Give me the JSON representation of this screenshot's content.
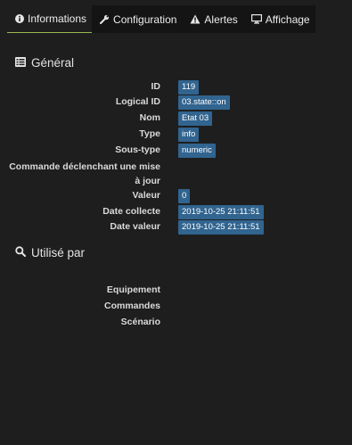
{
  "tabs": [
    {
      "label": "Informations",
      "icon": "info-circle-icon",
      "active": true
    },
    {
      "label": "Configuration",
      "icon": "wrench-icon",
      "active": false
    },
    {
      "label": "Alertes",
      "icon": "warning-icon",
      "active": false
    },
    {
      "label": "Affichage",
      "icon": "monitor-icon",
      "active": false
    }
  ],
  "general": {
    "title": "Général",
    "icon": "list-icon",
    "fields": [
      {
        "label": "ID",
        "value": "119"
      },
      {
        "label": "Logical ID",
        "value": "03.state::on"
      },
      {
        "label": "Nom",
        "value": "Etat 03"
      },
      {
        "label": "Type",
        "value": "info"
      },
      {
        "label": "Sous-type",
        "value": "numeric"
      },
      {
        "label": "Commande déclenchant une mise à jour",
        "value": ""
      },
      {
        "label": "Valeur",
        "value": "0"
      },
      {
        "label": "Date collecte",
        "value": "2019-10-25 21:11:51"
      },
      {
        "label": "Date valeur",
        "value": "2019-10-25 21:11:51"
      }
    ]
  },
  "used_by": {
    "title": "Utilisé par",
    "icon": "search-icon",
    "fields": [
      {
        "label": "Equipement"
      },
      {
        "label": "Commandes"
      },
      {
        "label": "Scénario"
      }
    ]
  },
  "colors": {
    "accent": "#9bb94f",
    "badge": "#31648f",
    "background": "#1e1e1e"
  }
}
